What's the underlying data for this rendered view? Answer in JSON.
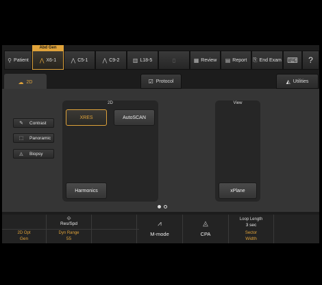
{
  "toolbar": {
    "abd_gen": "Abd Gen",
    "patient": "Patient",
    "x61": "X6-1",
    "c51": "C5-1",
    "c92": "C9-2",
    "l185": "L18-5",
    "review": "Review",
    "report": "Report",
    "end_exam": "End Exam",
    "help": "?"
  },
  "tabs": {
    "t2d": "2D",
    "protocol": "Protocol",
    "utilities": "Utilities"
  },
  "side": {
    "contrast": "Contrast",
    "panoramic": "Panoramic",
    "biopsy": "Biopsy"
  },
  "group2d": {
    "title": "2D",
    "xres": "XRES",
    "autoscan": "AutoSCAN",
    "harmonics": "Harmonics"
  },
  "view": {
    "title": "View",
    "xplane": "xPlane"
  },
  "bottom": {
    "opt_label": "2D Opt",
    "opt_value": "Gen",
    "res_label": "Res/Spd",
    "dyn_label": "Dyn Range",
    "dyn_value": "55",
    "mmode": "M-mode",
    "cpa": "CPA",
    "loop_label": "Loop Length",
    "loop_value": "3 sec",
    "sector_label": "Sector",
    "sector_value": "Width"
  },
  "colors": {
    "accent": "#e0a33a",
    "panel": "#353535",
    "group": "#262626"
  },
  "pagination": {
    "current": 1,
    "total": 2
  }
}
